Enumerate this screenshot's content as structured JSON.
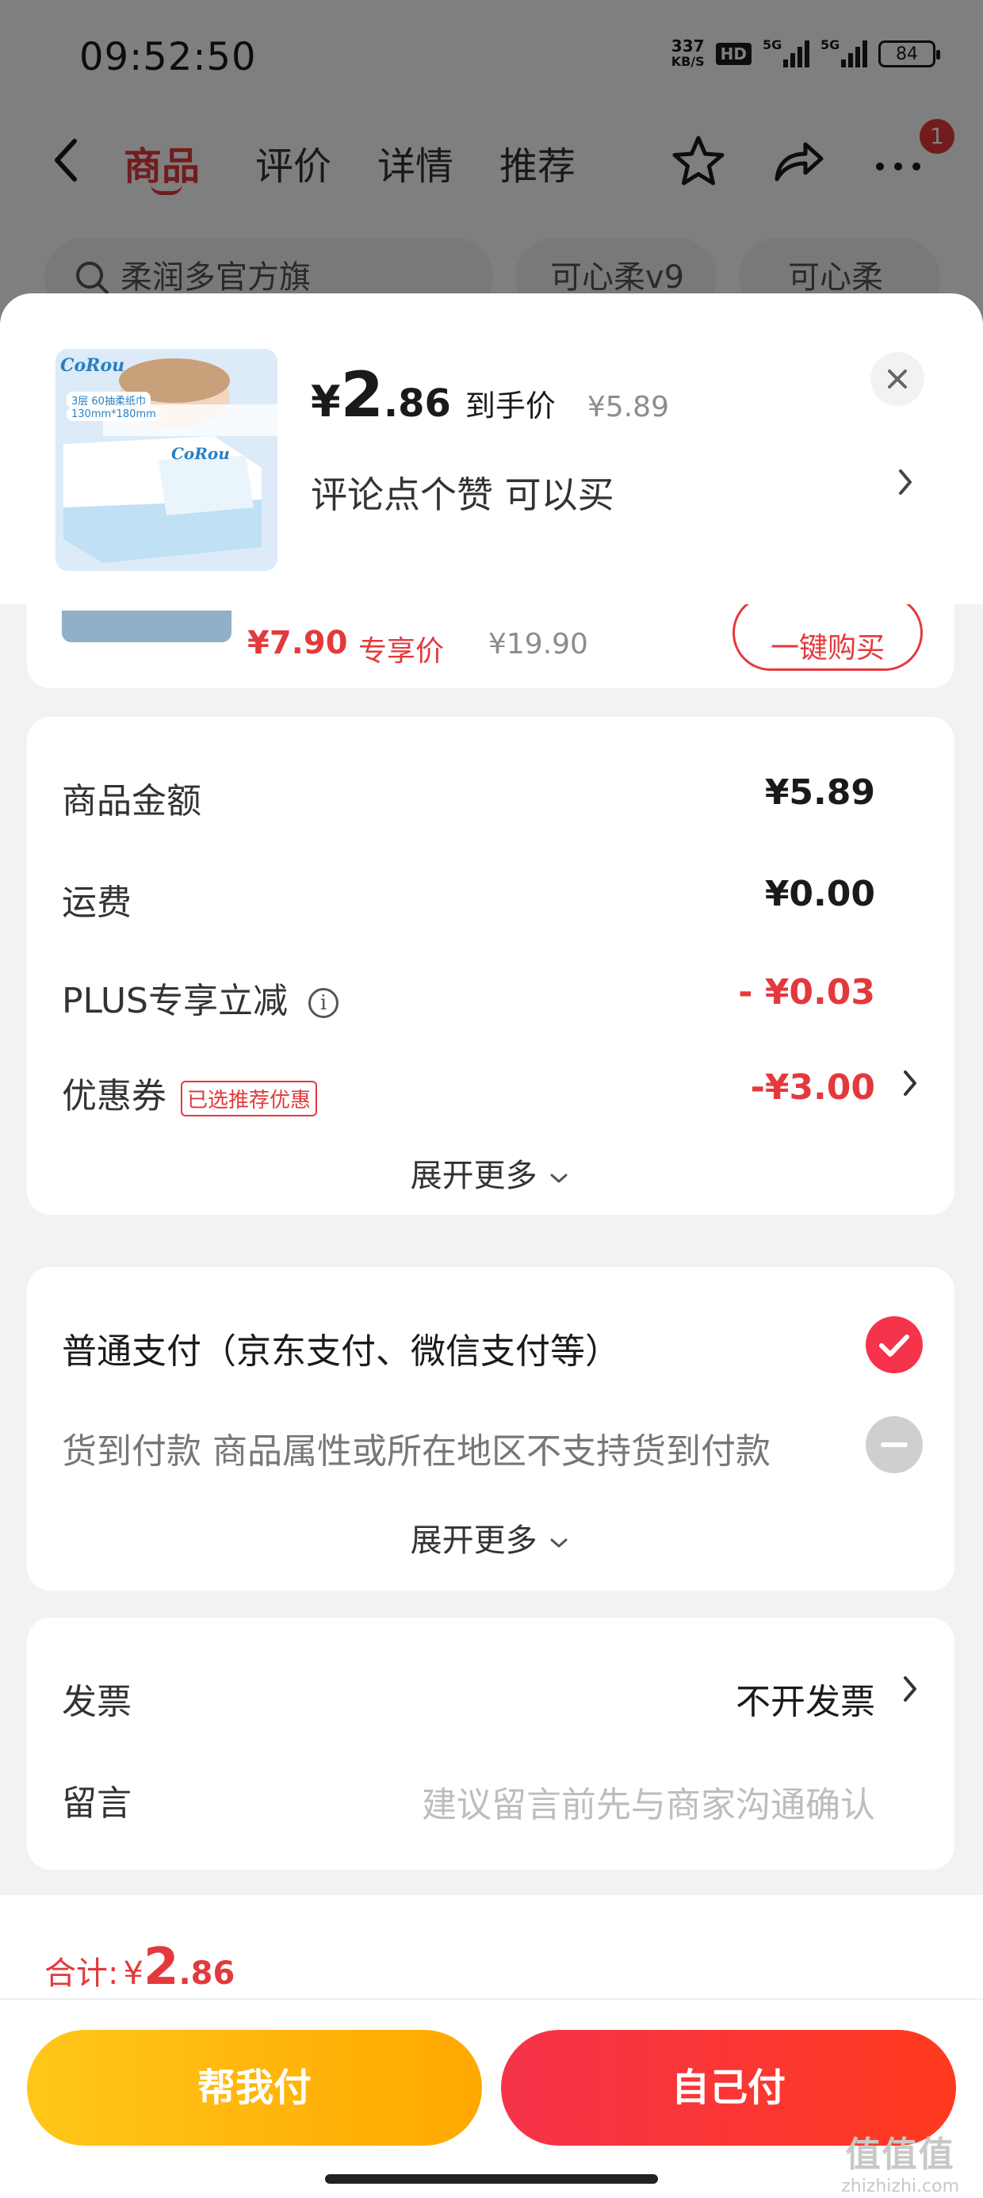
{
  "status_bar": {
    "time": "09:52:50",
    "net_speed": "337",
    "net_speed_unit": "KB/S",
    "hd_label": "HD",
    "sim1": "5G",
    "sim2": "5G",
    "battery": "84"
  },
  "nav": {
    "tabs": [
      {
        "label": "商品",
        "active": true
      },
      {
        "label": "评价"
      },
      {
        "label": "详情"
      },
      {
        "label": "推荐"
      }
    ],
    "badge_count": "1"
  },
  "search_chips": [
    "柔润多官方旗",
    "可心柔v9",
    "可心柔"
  ],
  "product": {
    "price_symbol": "¥",
    "price_int": "2",
    "price_dec": ".86",
    "price_label": "到手价",
    "original_price": "¥5.89",
    "promo_text": "评论点个赞  可以买",
    "image_brand": "CoRou",
    "image_spec_1": "3层 60抽柔纸巾",
    "image_spec_2": "130mm*180mm"
  },
  "peek_item": {
    "price": "¥7.90",
    "price_tag": "专享价",
    "original_price": "¥19.90",
    "button_label": "一键购买"
  },
  "summary": {
    "rows": [
      {
        "label": "商品金额",
        "value": "¥5.89"
      },
      {
        "label": "运费",
        "value": "¥0.00"
      },
      {
        "label": "PLUS专享立减",
        "value": "- ¥0.03"
      },
      {
        "label": "优惠券",
        "tag": "已选推荐优惠",
        "value": "-¥3.00"
      }
    ],
    "expand_label": "展开更多"
  },
  "payment": {
    "options": [
      {
        "label": "普通支付（京东支付、微信支付等）",
        "selected": true
      },
      {
        "label": "货到付款 商品属性或所在地区不支持货到付款",
        "disabled": true
      }
    ],
    "expand_label": "展开更多"
  },
  "extra": {
    "invoice_label": "发票",
    "invoice_value": "不开发票",
    "message_label": "留言",
    "message_placeholder": "建议留言前先与商家沟通确认"
  },
  "footer": {
    "total_label": "合计:",
    "total_symbol": "¥",
    "total_int": "2",
    "total_dec": ".86",
    "help_pay_label": "帮我付",
    "self_pay_label": "自己付"
  },
  "watermark": {
    "mark": "值值值",
    "domain": "zhizhizhi.com"
  },
  "colors": {
    "accent_red": "#e4393c",
    "pay_yellow": "#ffb400",
    "pay_red": "#f5334a"
  }
}
